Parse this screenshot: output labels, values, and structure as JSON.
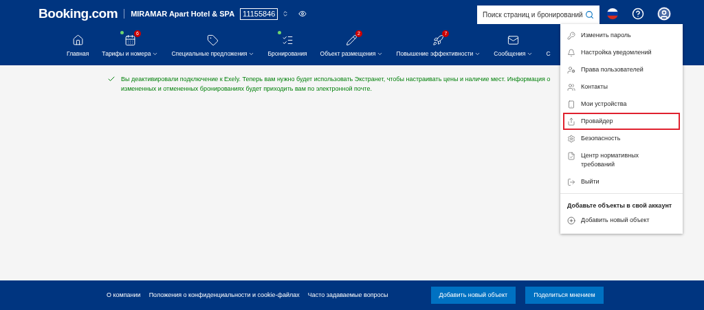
{
  "header": {
    "logo": "Booking.com",
    "property_name": "MIRAMAR Apart Hotel & SPA",
    "property_id": "11155846",
    "search": {
      "placeholder": "Поиск страниц и бронирований"
    }
  },
  "nav": [
    {
      "label": "Главная",
      "dropdown": false,
      "dot": false
    },
    {
      "label": "Тарифы и номера",
      "dropdown": true,
      "dot": true,
      "badge": "6"
    },
    {
      "label": "Специальные предложения",
      "dropdown": true,
      "dot": false
    },
    {
      "label": "Бронирования",
      "dropdown": false,
      "dot": true
    },
    {
      "label": "Объект размещения",
      "dropdown": true,
      "dot": false,
      "badge": "2"
    },
    {
      "label": "Повышение эффективности",
      "dropdown": true,
      "dot": false,
      "badge": "7"
    },
    {
      "label": "Сообщения",
      "dropdown": true,
      "dot": false
    },
    {
      "label": "С"
    }
  ],
  "notice": "Вы деактивировали подключение к Exely. Теперь вам нужно будет использовать Экстранет, чтобы настраивать цены и наличие мест. Информация о измененных и отмененных бронированиях будет приходить вам по электронной почте.",
  "account_menu": {
    "items": [
      {
        "label": "Изменить пароль",
        "highlighted": false
      },
      {
        "label": "Настройка уведомлений",
        "highlighted": false
      },
      {
        "label": "Права пользователей",
        "highlighted": false
      },
      {
        "label": "Контакты",
        "highlighted": false
      },
      {
        "label": "Мои устройства",
        "highlighted": false
      },
      {
        "label": "Провайдер",
        "highlighted": true
      },
      {
        "label": "Безопасность",
        "highlighted": false
      },
      {
        "label": "Центр нормативных требований",
        "highlighted": false
      },
      {
        "label": "Выйти",
        "highlighted": false
      }
    ],
    "section_title": "Добавьте объекты в свой аккаунт",
    "add_item": "Добавить новый объект"
  },
  "footer": {
    "links": [
      "О компании",
      "Положения о конфиденциальности и cookie-файлах",
      "Часто задаваемые вопросы"
    ],
    "buttons": [
      "Добавить новый объект",
      "Поделиться мнением"
    ]
  }
}
